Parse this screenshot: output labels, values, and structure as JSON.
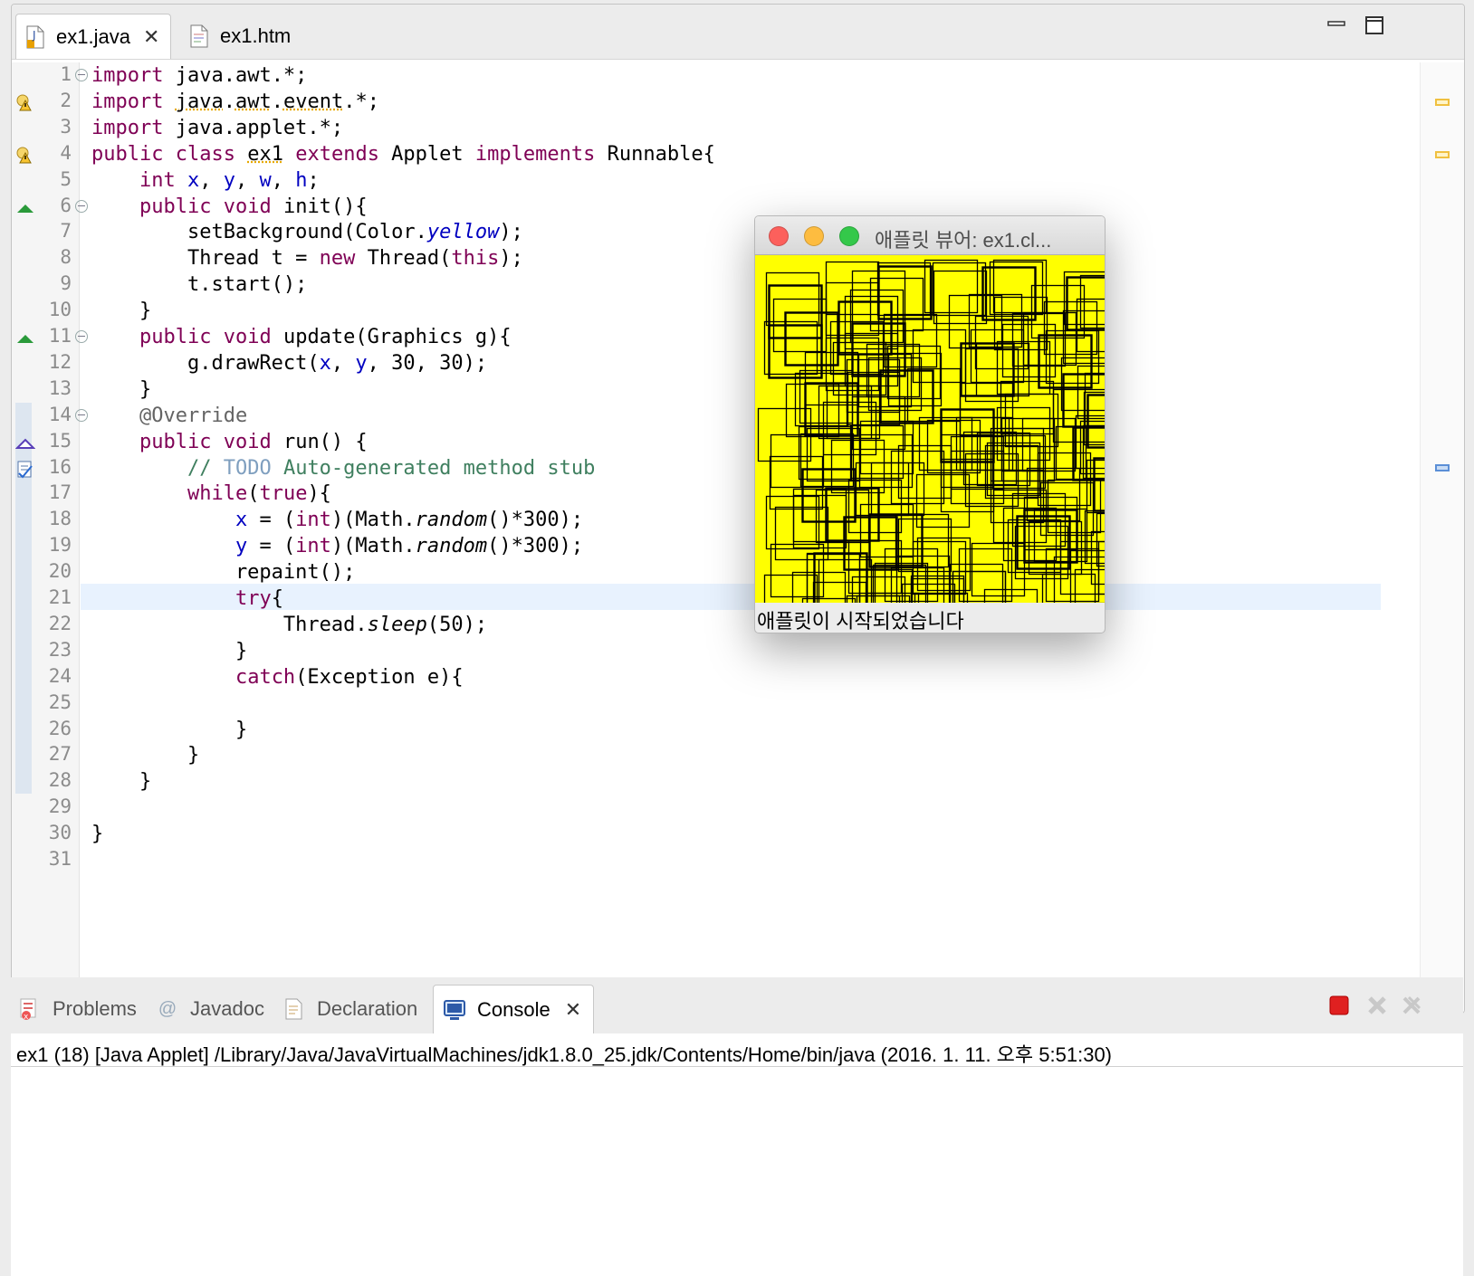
{
  "editor": {
    "tabs": [
      {
        "label": "ex1.java",
        "icon": "java-file-icon",
        "active": true
      },
      {
        "label": "ex1.htm",
        "icon": "html-file-icon",
        "active": false
      }
    ],
    "window_controls": [
      "minimize-icon",
      "maximize-icon"
    ],
    "line_numbers": [
      "1",
      "2",
      "3",
      "4",
      "5",
      "6",
      "7",
      "8",
      "9",
      "10",
      "11",
      "12",
      "13",
      "14",
      "15",
      "16",
      "17",
      "18",
      "19",
      "20",
      "21",
      "22",
      "23",
      "24",
      "25",
      "26",
      "27",
      "28",
      "29",
      "30",
      "31"
    ],
    "code_lines": [
      "import java.awt.*;",
      "import java.awt.event.*;",
      "import java.applet.*;",
      "public class ex1 extends Applet implements Runnable{",
      "    int x, y, w, h;",
      "    public void init(){",
      "        setBackground(Color.yellow);",
      "        Thread t = new Thread(this);",
      "        t.start();",
      "    }",
      "    public void update(Graphics g){",
      "        g.drawRect(x, y, 30, 30);",
      "    }",
      "    @Override",
      "    public void run() {",
      "        // TODO Auto-generated method stub",
      "        while(true){",
      "            x = (int)(Math.random()*300);",
      "            y = (int)(Math.random()*300);",
      "            repaint();",
      "            try{",
      "                Thread.sleep(50);",
      "            }",
      "            catch(Exception e){",
      "",
      "            }",
      "        }",
      "    }",
      "",
      "}",
      ""
    ],
    "current_line": 21,
    "gutter_markers": {
      "2": "warning-icon",
      "4": "warning-icon",
      "6": "override-icon",
      "11": "override-icon",
      "15": "implements-icon",
      "16": "task-icon"
    },
    "fold_lines": [
      1,
      6,
      11,
      14
    ]
  },
  "applet_window": {
    "title": "애플릿 뷰어: ex1.cl...",
    "status": "애플릿이 시작되었습니다",
    "background": "#ffff00",
    "traffic_lights": [
      "#fc605c",
      "#fdbc40",
      "#34c84a"
    ]
  },
  "console": {
    "tabs": [
      {
        "label": "Problems",
        "icon": "problems-icon"
      },
      {
        "label": "Javadoc",
        "icon": "javadoc-icon"
      },
      {
        "label": "Declaration",
        "icon": "declaration-icon"
      },
      {
        "label": "Console",
        "icon": "console-icon",
        "active": true
      }
    ],
    "header": "ex1 (18) [Java Applet] /Library/Java/JavaVirtualMachines/jdk1.8.0_25.jdk/Contents/Home/bin/java (2016. 1. 11. 오후 5:51:30)"
  }
}
